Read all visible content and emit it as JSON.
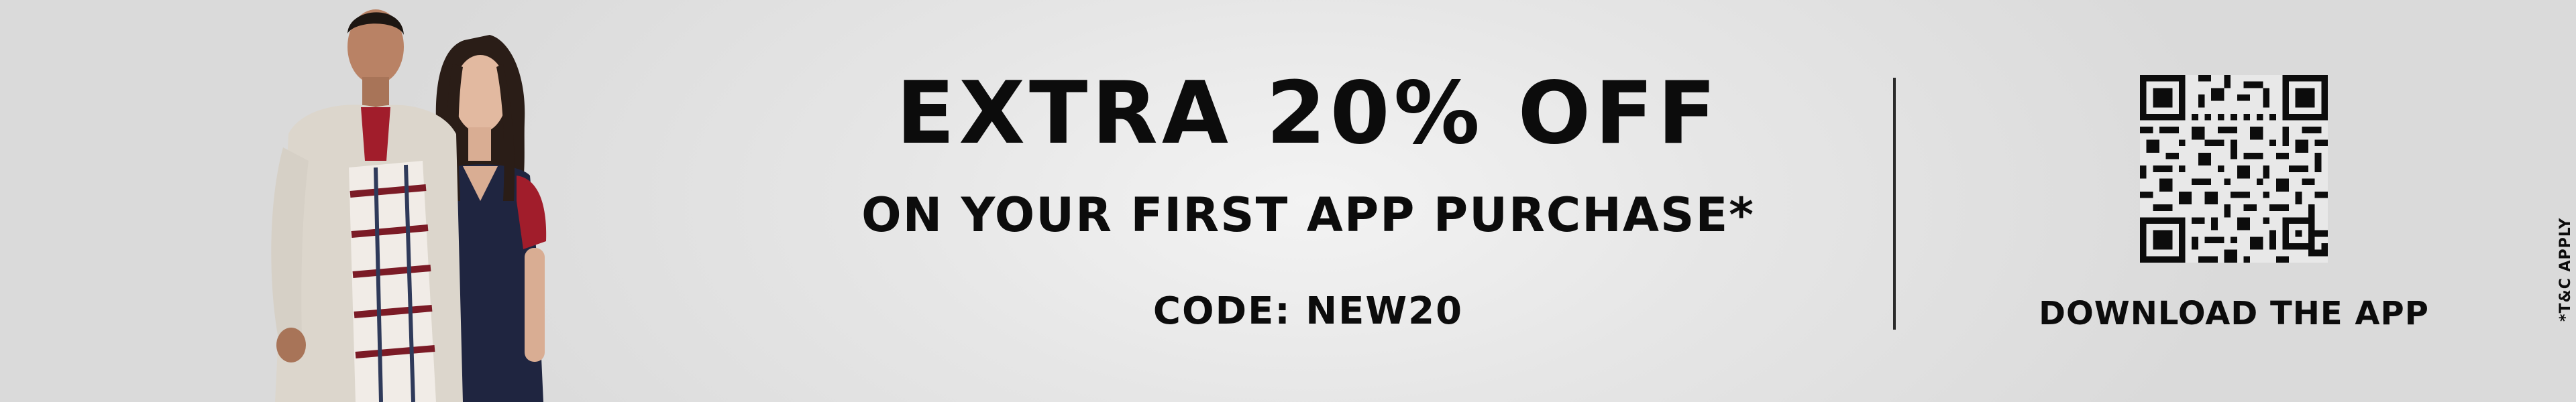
{
  "promo": {
    "headline": "EXTRA 20% OFF",
    "subline": "ON YOUR FIRST APP PURCHASE*",
    "code": "CODE: NEW20"
  },
  "app": {
    "cta": "DOWNLOAD THE APP",
    "qr_icon": "qr-code-icon"
  },
  "legal": {
    "terms": "*T&C APPLY"
  },
  "colors": {
    "text": "#0c0c0c",
    "background": "#e6e6e6",
    "shirt_red": "#a11d2b",
    "dress_navy": "#1f2540"
  }
}
